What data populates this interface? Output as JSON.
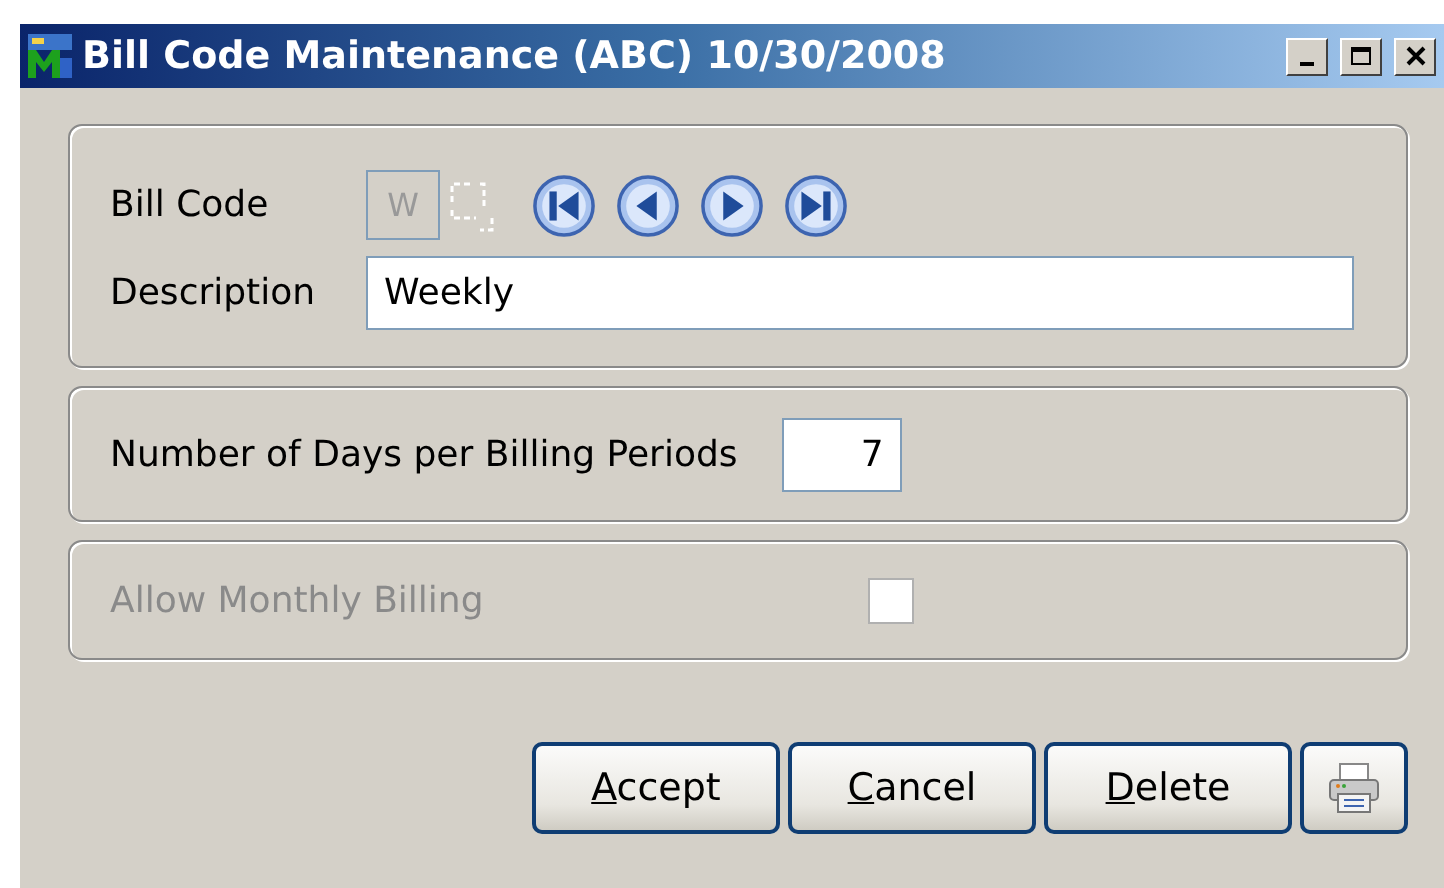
{
  "window": {
    "title": "Bill Code Maintenance (ABC) 10/30/2008"
  },
  "header_panel": {
    "bill_code": {
      "label": "Bill Code",
      "value": "W",
      "disabled": true
    },
    "description": {
      "label": "Description",
      "value": "Weekly"
    }
  },
  "days_panel": {
    "label": "Number of Days per Billing Periods",
    "value": "7"
  },
  "monthly_panel": {
    "label": "Allow Monthly Billing",
    "checked": false,
    "disabled": true
  },
  "buttons": [
    {
      "kind": "text",
      "label": "Accept"
    },
    {
      "kind": "text",
      "label": "Cancel"
    },
    {
      "kind": "text",
      "label": "Delete"
    },
    {
      "kind": "print"
    }
  ]
}
